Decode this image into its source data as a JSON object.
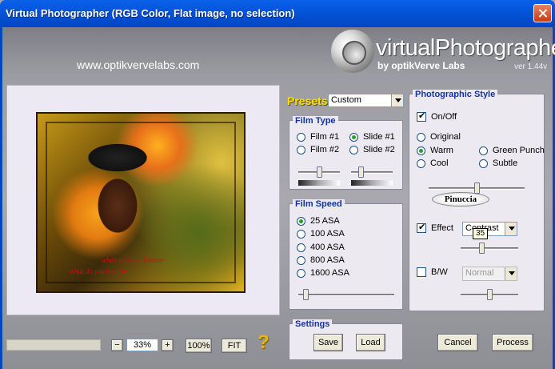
{
  "window": {
    "title": "Virtual Photographer (RGB Color, Flat image, no selection)"
  },
  "header": {
    "website": "www.optikvervelabs.com",
    "logo_text": "virtualPhotographer",
    "logo_sub": "by optikVerve Labs",
    "version": "ver 1.44v"
  },
  "preview": {
    "text_line1": "when you live forever",
    "text_line2": "what do you live for"
  },
  "bottom": {
    "minus": "−",
    "zoom": "33%",
    "plus": "+",
    "hundred": "100%",
    "fit": "FIT",
    "help": "?"
  },
  "presets": {
    "label": "Presets",
    "value": "Custom"
  },
  "film_type": {
    "title": "Film Type",
    "options": [
      "Film #1",
      "Slide #1",
      "Film #2",
      "Slide #2"
    ],
    "selected": "Slide #1",
    "slider1": 0.5,
    "slider2": 0.2
  },
  "film_speed": {
    "title": "Film Speed",
    "options": [
      "25 ASA",
      "100 ASA",
      "400 ASA",
      "800 ASA",
      "1600 ASA"
    ],
    "selected": "25 ASA",
    "slider": 0.05
  },
  "settings": {
    "title": "Settings",
    "save": "Save",
    "load": "Load"
  },
  "photographic_style": {
    "title": "Photographic Style",
    "onoff": "On/Off",
    "onoff_checked": true,
    "styles": [
      "Original",
      "Warm",
      "Green Punch",
      "Cool",
      "Subtle"
    ],
    "selected": "Warm",
    "slider": 0.5,
    "badge": "Pinuccia",
    "effect_label": "Effect",
    "effect_checked": true,
    "effect_value": "Contrast",
    "effect_tooltip": "35",
    "effect_slider": 0.35,
    "bw_label": "B/W",
    "bw_checked": false,
    "bw_value": "Normal",
    "bw_slider": 0.5
  },
  "actions": {
    "cancel": "Cancel",
    "process": "Process"
  },
  "colors": {
    "titlebar": "#0453d8",
    "presets_label": "#ffe000",
    "panel_title": "#12349c"
  }
}
